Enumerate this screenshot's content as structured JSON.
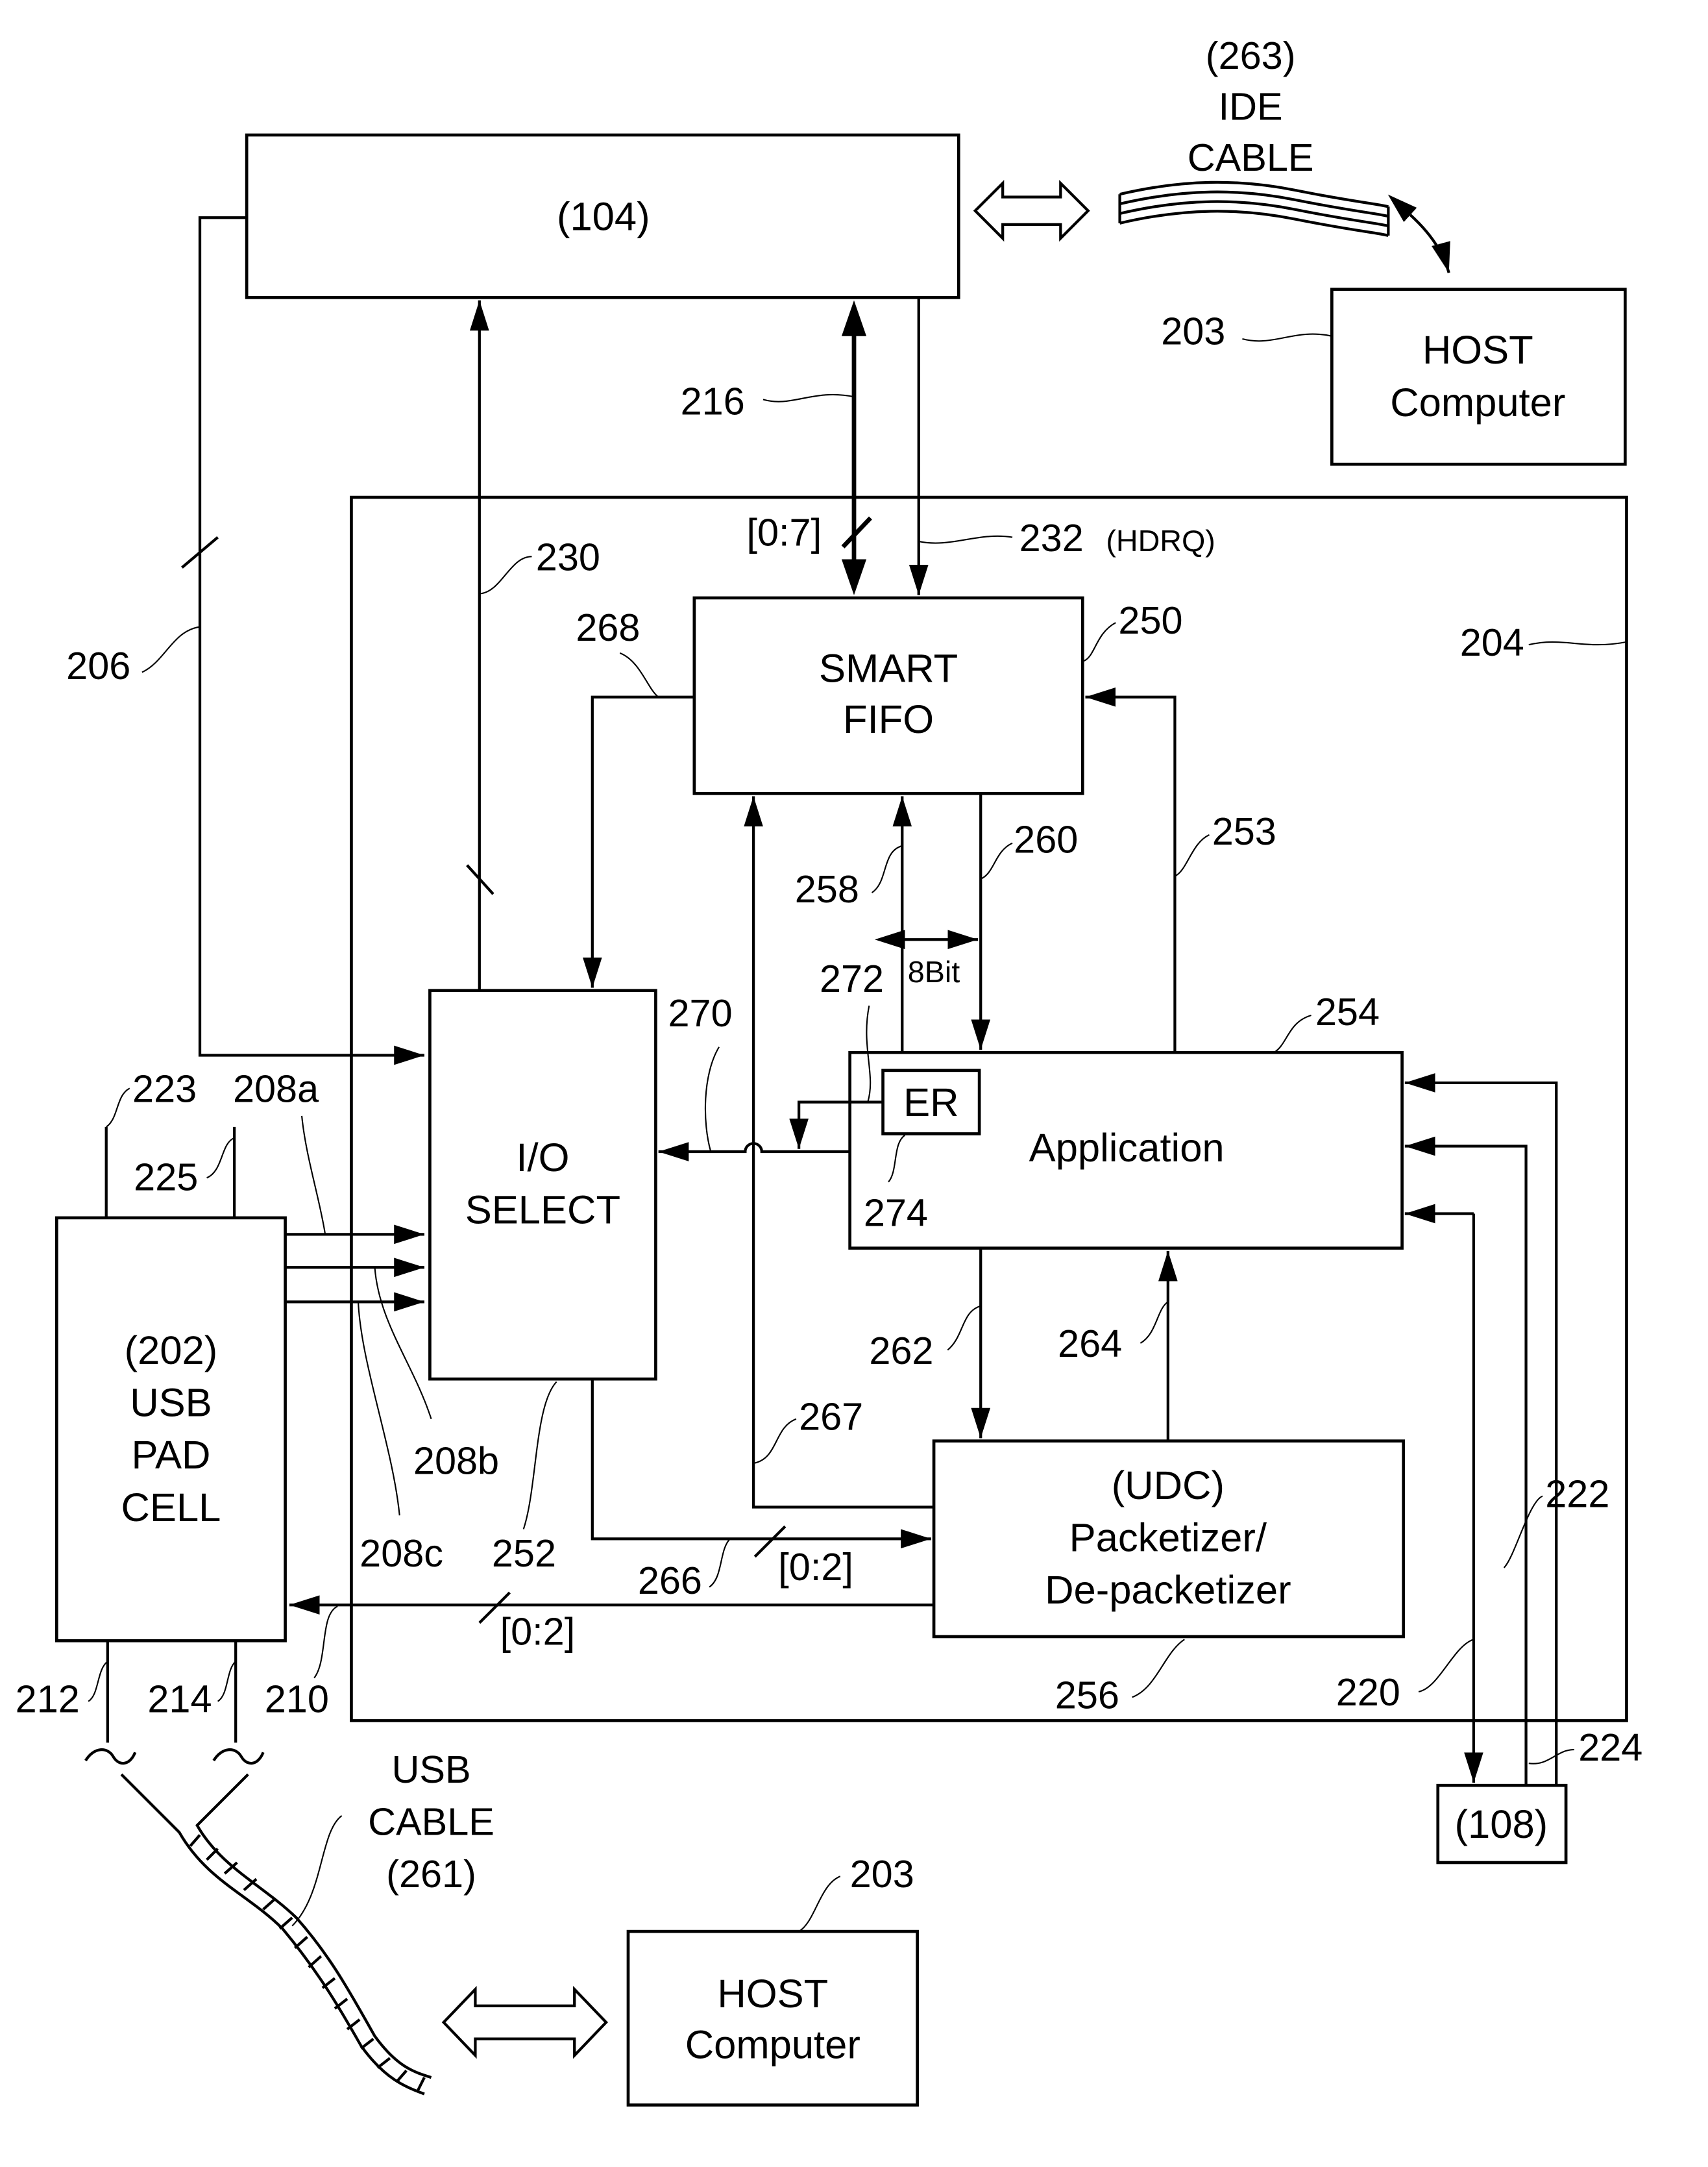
{
  "blocks": {
    "ide_controller": {
      "label": "(104)"
    },
    "host_top": {
      "ref": "203",
      "line1": "HOST",
      "line2": "Computer"
    },
    "ide_cable": {
      "line1": "(263)",
      "line2": "IDE",
      "line3": "CABLE"
    },
    "chip": {
      "ref": "204"
    },
    "smart_fifo": {
      "ref": "250",
      "line1": "SMART",
      "line2": "FIFO"
    },
    "io_select": {
      "ref": "252",
      "line1": "I/O",
      "line2": "SELECT"
    },
    "application": {
      "ref": "254",
      "label": "Application"
    },
    "er": {
      "label": "ER",
      "ref": "274"
    },
    "udc": {
      "ref": "256",
      "line1": "(UDC)",
      "line2": "Packetizer/",
      "line3": "De-packetizer"
    },
    "usb_pad_cell": {
      "line1": "(202)",
      "line2": "USB",
      "line3": "PAD",
      "line4": "CELL"
    },
    "block_108": {
      "label": "(108)"
    },
    "usb_cable": {
      "line1": "USB",
      "line2": "CABLE",
      "line3": "(261)"
    },
    "host_bottom": {
      "ref": "203",
      "line1": "HOST",
      "line2": "Computer"
    }
  },
  "signals": {
    "s206": "206",
    "s216": "216",
    "s230": "230",
    "s232": "232",
    "s232_name": "(HDRQ)",
    "bus_0_7": "[0:7]",
    "s268": "268",
    "s253": "253",
    "s258": "258",
    "s260": "260",
    "bit_width": "8Bit",
    "s272": "272",
    "s270": "270",
    "s223": "223",
    "s225": "225",
    "s208a": "208a",
    "s208b": "208b",
    "s208c": "208c",
    "s262": "262",
    "s264": "264",
    "s267": "267",
    "s266": "266",
    "bus_0_2_a": "[0:2]",
    "bus_0_2_b": "[0:2]",
    "s210": "210",
    "s212": "212",
    "s214": "214",
    "s220": "220",
    "s222": "222",
    "s224": "224"
  }
}
